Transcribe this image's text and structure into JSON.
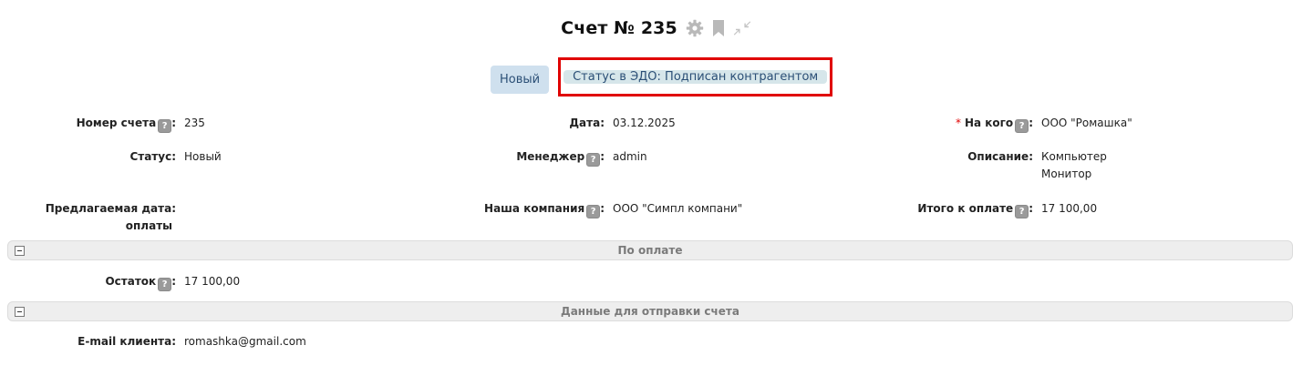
{
  "header": {
    "title": "Счет № 235",
    "icons": [
      "gear-icon",
      "bookmark-icon",
      "collapse-arrows-icon"
    ]
  },
  "status_chips": {
    "status": "Новый",
    "edo_status": "Статус в ЭДО: Подписан контрагентом"
  },
  "fields": {
    "invoice_number": {
      "label": "Номер счета",
      "value": "235"
    },
    "date": {
      "label": "Дата",
      "value": "03.12.2025"
    },
    "to_whom": {
      "required_mark": "*",
      "label": "На кого",
      "value": "ООО \"Ромашка\""
    },
    "status": {
      "label": "Статус",
      "value": "Новый"
    },
    "manager": {
      "label": "Менеджер",
      "value": "admin"
    },
    "description": {
      "label": "Описание",
      "value_line1": "Компьютер",
      "value_line2": "Монитор"
    },
    "proposed_date": {
      "label_line1": "Предлагаемая дата:",
      "label_line2": "оплаты",
      "value": ""
    },
    "our_company": {
      "label": "Наша компания",
      "value": "ООО \"Симпл компани\""
    },
    "total": {
      "label": "Итого к оплате",
      "value": "17 100,00"
    },
    "balance": {
      "label": "Остаток",
      "value": "17 100,00"
    },
    "client_email": {
      "label": "E-mail клиента",
      "value": "romashka@gmail.com"
    }
  },
  "sections": {
    "payment": "По оплате",
    "send_data": "Данные для отправки счета"
  },
  "help_glyph": "?",
  "colon": ":",
  "colors": {
    "chip_bg": "#cfe0ee",
    "chip_text": "#2b4f76",
    "highlight_border": "#e00000",
    "required": "#e00000"
  }
}
